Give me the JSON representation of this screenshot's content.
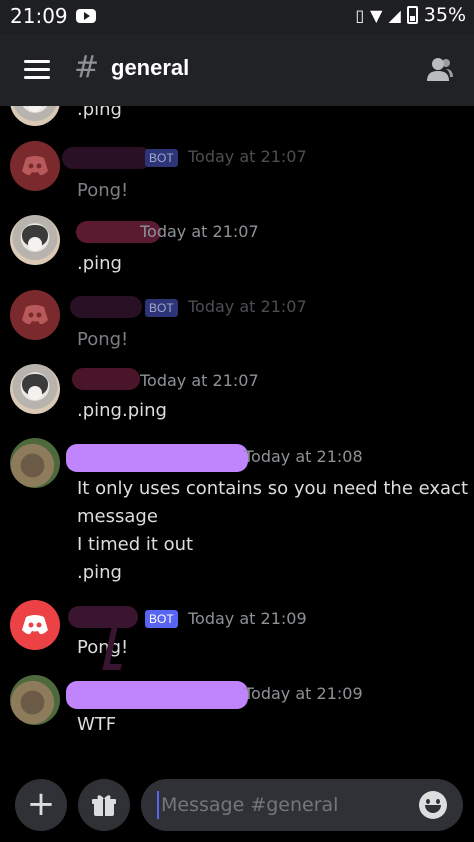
{
  "status_bar": {
    "time": "21:09",
    "battery": "35%"
  },
  "header": {
    "channel": "general",
    "icons": [
      "menu-icon",
      "hash-icon",
      "members-icon"
    ]
  },
  "messages": [
    {
      "avatar": "cat",
      "content": ".ping"
    },
    {
      "avatar": "discord",
      "badge": "BOT",
      "timestamp": "Today at 21:07",
      "content": "Pong!",
      "faded": true
    },
    {
      "avatar": "cat",
      "timestamp": "Today at 21:07",
      "content": ".ping"
    },
    {
      "avatar": "discord",
      "badge": "BOT",
      "timestamp": "Today at 21:07",
      "content": "Pong!",
      "faded": true
    },
    {
      "avatar": "cat",
      "timestamp": "Today at 21:07",
      "content": ".ping.ping"
    },
    {
      "avatar": "dog",
      "timestamp": "Today at 21:08",
      "content_lines": [
        "It only uses contains so you need the exact",
        "message",
        "I timed it out",
        ".ping"
      ]
    },
    {
      "avatar": "discord",
      "badge": "BOT",
      "timestamp": "Today at 21:09",
      "content": "Pong!"
    },
    {
      "avatar": "dog",
      "timestamp": "Today at 21:09",
      "content": "WTF"
    }
  ],
  "composer": {
    "placeholder": "Message #general"
  },
  "colors": {
    "accent": "#5865f2",
    "discord_red": "#ed4245",
    "redaction_purple": "#c084fc",
    "redaction_dark": "#3a1530"
  }
}
